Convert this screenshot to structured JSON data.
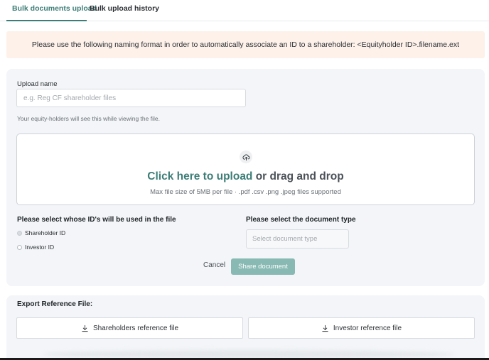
{
  "tabs": {
    "active": "Bulk documents upload",
    "inactive": "Bulk upload history"
  },
  "banner": {
    "text": "Please use the following naming format in order to automatically associate an ID to a shareholder: <Equityholder ID>.filename.ext"
  },
  "upload": {
    "name_label": "Upload name",
    "name_placeholder": "e.g. Reg CF shareholder files",
    "name_value": "",
    "hint": "Your equity-holders will see this while viewing the file.",
    "drop_link": "Click here to upload",
    "drop_rest": " or drag and drop",
    "drop_sub": "Max file size of 5MB per file · .pdf .csv .png .jpeg files supported"
  },
  "ids": {
    "title": "Please select whose ID's will be used in the file",
    "options": [
      "Shareholder ID",
      "Investor ID"
    ],
    "selected": "Shareholder ID"
  },
  "doc_type": {
    "title": "Please select the document type",
    "placeholder": "Select document type"
  },
  "actions": {
    "cancel": "Cancel",
    "share": "Share document"
  },
  "export": {
    "title": "Export Reference File:",
    "shareholders": "Shareholders reference file",
    "investor": "Investor reference file"
  },
  "colors": {
    "accent": "#3d7d77",
    "share_button": "#88b9b3",
    "banner_bg": "#fdf1ea",
    "panel_bg": "#f3f5f8"
  },
  "icons": {
    "upload": "cloud-upload-icon",
    "download": "download-icon"
  }
}
